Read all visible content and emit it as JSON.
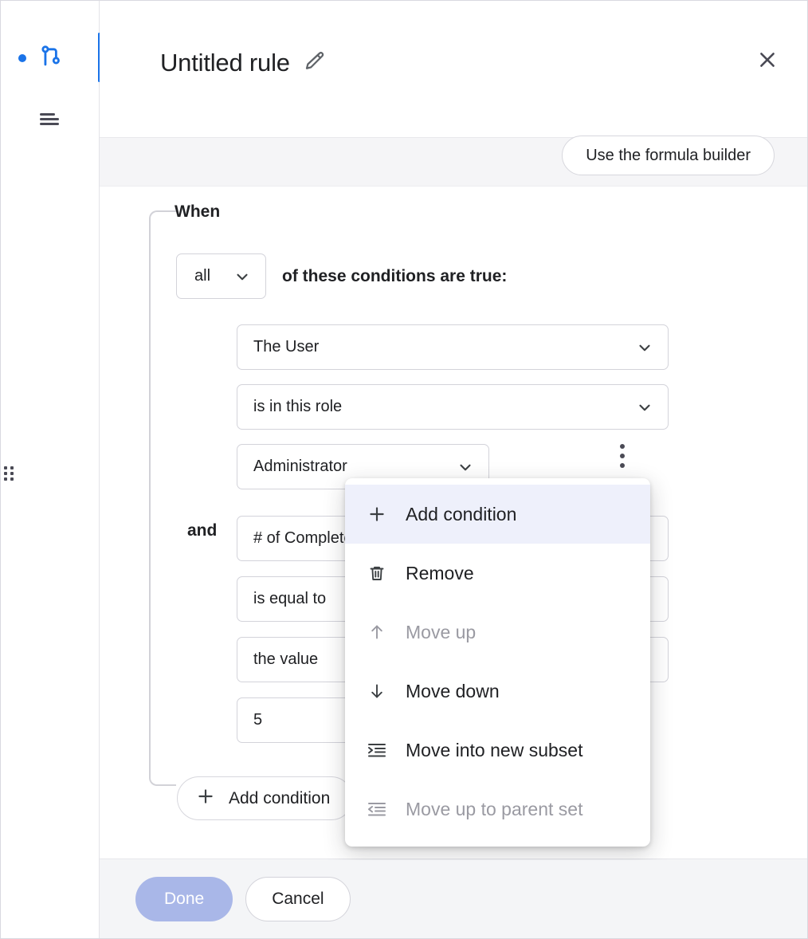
{
  "sidebar": {
    "rule_icon": "branch-rule-icon",
    "status_dot": "active-dot",
    "menu_icon": "hamburger-menu-icon",
    "drag_handle": "drag-handle-dots"
  },
  "header": {
    "title": "Untitled rule",
    "edit_icon": "pencil-icon",
    "close_icon": "close-icon"
  },
  "toolbar": {
    "formula_builder_label": "Use the formula builder"
  },
  "rule": {
    "when_label": "When",
    "scope_value": "all",
    "scope_suffix": "of these conditions are true:",
    "and_label": "and",
    "add_condition_label": "Add condition",
    "add_icon": "plus-icon",
    "kebab_icon": "more-vertical-icon",
    "conditions": [
      {
        "subject": "The User",
        "operator": "is in this role",
        "value": "Administrator"
      },
      {
        "subject": "# of Completed Tasks",
        "operator": "is equal to",
        "value_type": "the value",
        "value": "5"
      }
    ]
  },
  "context_menu": {
    "items": [
      {
        "label": "Add condition",
        "icon": "plus-icon",
        "disabled": false,
        "highlighted": true
      },
      {
        "label": "Remove",
        "icon": "trash-icon",
        "disabled": false,
        "highlighted": false
      },
      {
        "label": "Move up",
        "icon": "arrow-up-icon",
        "disabled": true,
        "highlighted": false
      },
      {
        "label": "Move down",
        "icon": "arrow-down-icon",
        "disabled": false,
        "highlighted": false
      },
      {
        "label": "Move into new subset",
        "icon": "indent-increase-icon",
        "disabled": false,
        "highlighted": false
      },
      {
        "label": "Move up to parent set",
        "icon": "indent-decrease-icon",
        "disabled": true,
        "highlighted": false
      }
    ]
  },
  "footer": {
    "done_label": "Done",
    "cancel_label": "Cancel"
  },
  "colors": {
    "accent": "#1a73e8",
    "done_button": "#a9b7e8",
    "menu_highlight": "#eef0fb",
    "strip_bg": "#f5f5f7"
  }
}
